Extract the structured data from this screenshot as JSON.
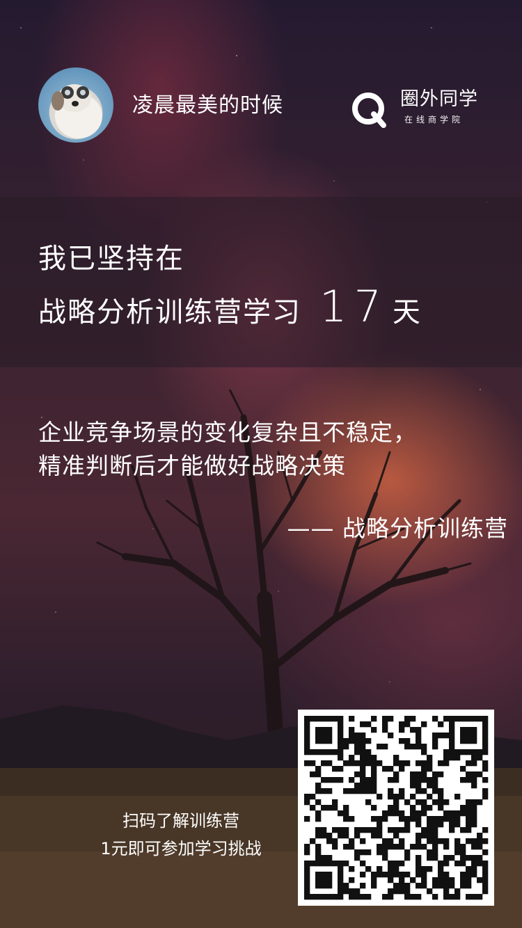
{
  "header": {
    "user_name": "凌晨最美的时候",
    "brand": {
      "name": "圈外同学",
      "subtitle": "在线商学院",
      "color": "#ffffff"
    }
  },
  "banner": {
    "line1": "我已坚持在",
    "camp_name": "战略分析训练营学习",
    "days": "17",
    "unit": "天"
  },
  "quote": {
    "line1": "企业竞争场景的变化复杂且不稳定，",
    "line2": "精准判断后才能做好战略决策",
    "author": "—— 战略分析训练营"
  },
  "cta": {
    "line1": "扫码了解训练营",
    "line2": "1元即可参加学习挑战"
  },
  "icons": {
    "avatar": "dog-avatar",
    "brand_logo": "q-logo-icon",
    "qr": "qr-code"
  }
}
